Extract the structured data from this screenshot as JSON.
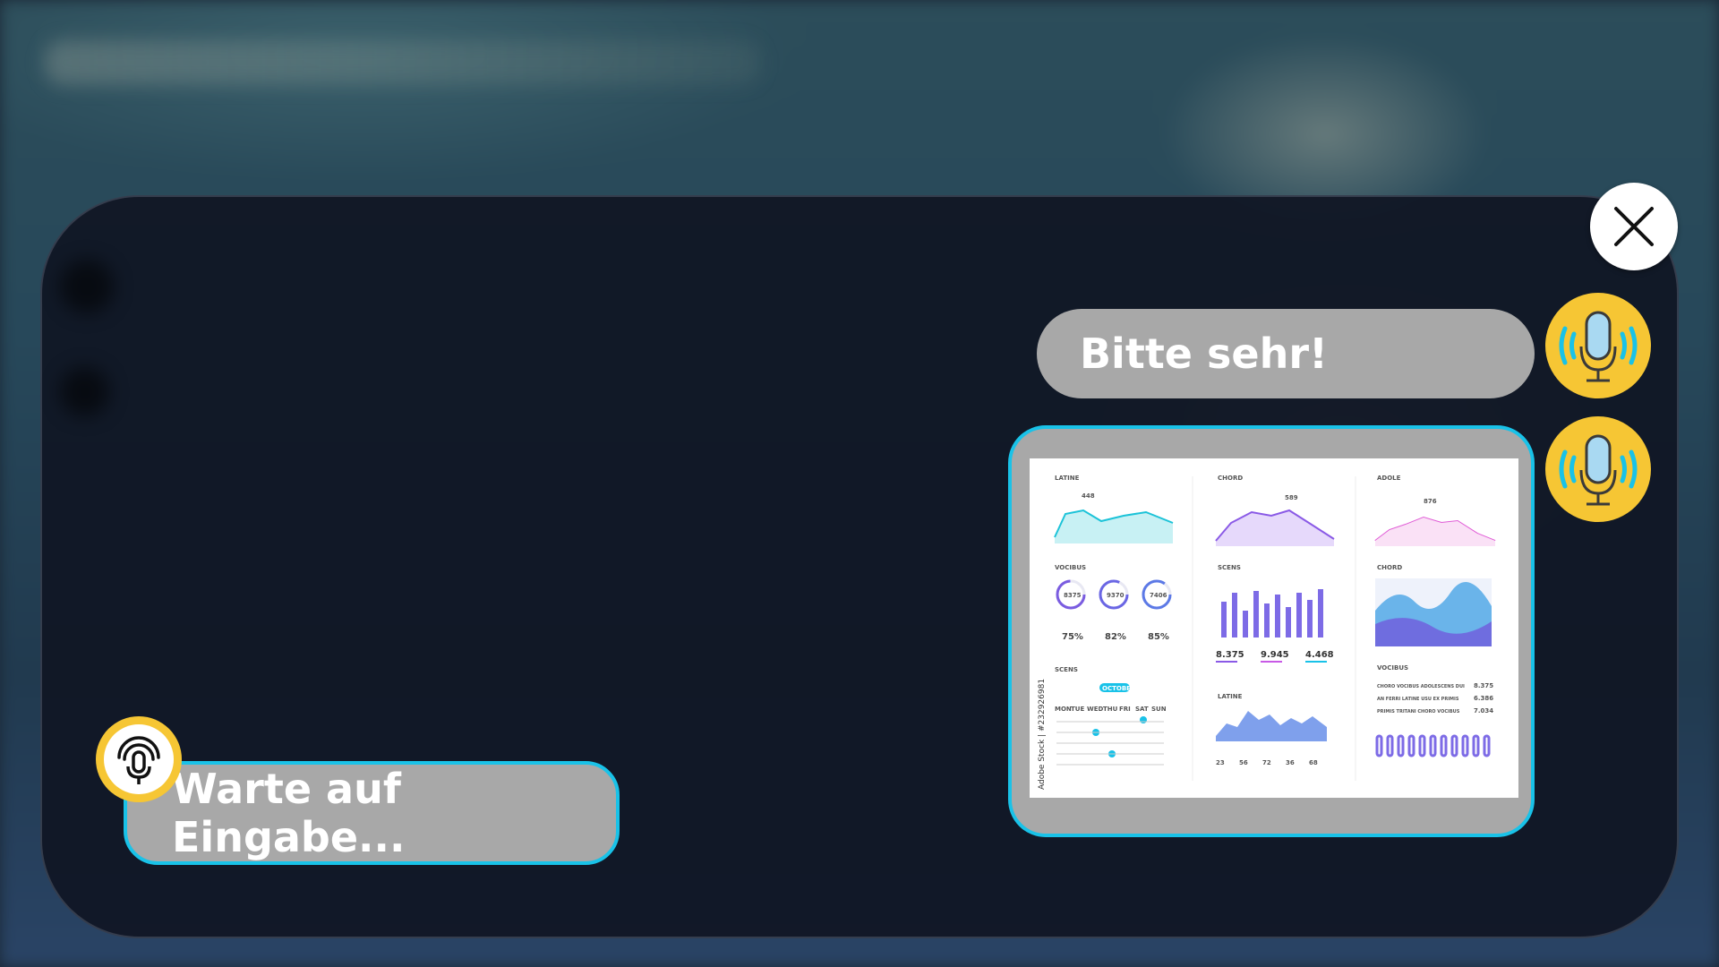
{
  "chat": {
    "messages": [
      {
        "text": "Bitte sehr!"
      },
      {
        "image_caption": "Adobe Stock | #232926981"
      }
    ]
  },
  "input": {
    "status_text": "Warte auf Eingabe..."
  },
  "dashboard": {
    "col1": {
      "title_top": "LATINE",
      "title_mid": "VOCIBUS",
      "title_bot": "SCENS",
      "ring_values": [
        "8375",
        "9370",
        "7406"
      ],
      "ring_percents": [
        "75%",
        "82%",
        "85%"
      ],
      "peak_label": "448",
      "month": "OCTOBER",
      "weekdays": [
        "MON",
        "TUE",
        "WED",
        "THU",
        "FRI",
        "SAT",
        "SUN"
      ]
    },
    "col2": {
      "title_top": "CHORD",
      "title_mid": "SCENS",
      "title_bot": "LATINE",
      "peak_label": "589",
      "stats": [
        "8.375",
        "9.945",
        "4.468"
      ],
      "bottom_values": [
        "23",
        "56",
        "72",
        "36",
        "68"
      ]
    },
    "col3": {
      "title_top": "ADOLE",
      "title_mid": "CHORD",
      "title_bot": "VOCIBUS",
      "peak_label": "876",
      "list": [
        {
          "label": "CHORO VOCIBUS ADOLESCENS DUI",
          "value": "8.375"
        },
        {
          "label": "AN FERRI LATINE USU EX PRIMIS",
          "value": "6.386"
        },
        {
          "label": "PRIMIS TRITANI CHORO VOCIBUS",
          "value": "7.034"
        }
      ]
    }
  },
  "colors": {
    "accent": "#19c2e8",
    "avatar": "#f6c634",
    "bubble": "#a8a8a8",
    "panel": "#10161f"
  },
  "icons": {
    "close": "close-icon",
    "mic": "microphone-icon",
    "input_mic": "microphone-signal-icon"
  }
}
